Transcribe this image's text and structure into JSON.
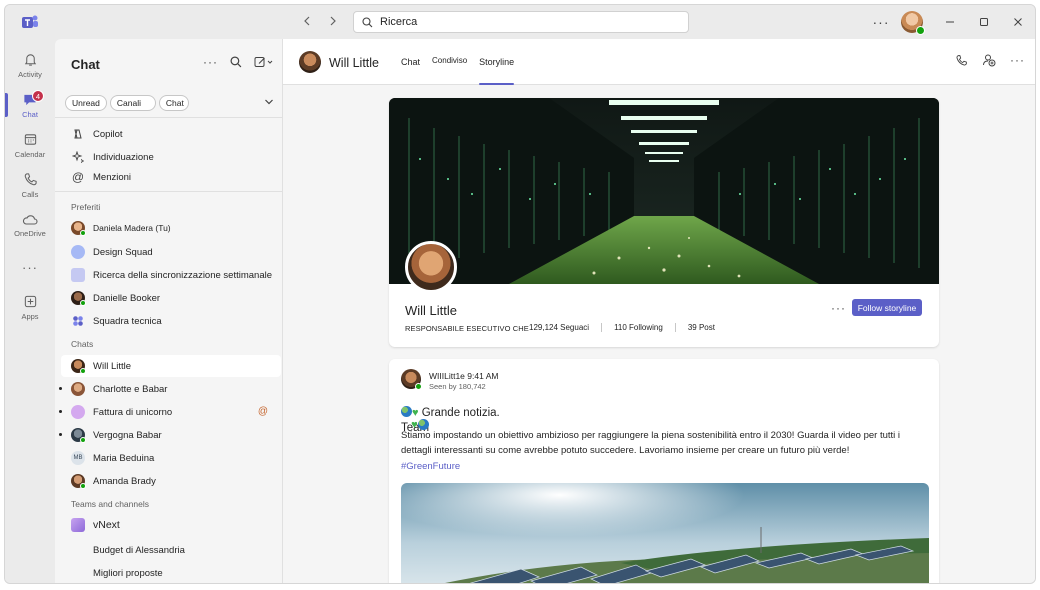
{
  "titlebar": {
    "search_placeholder": "Ricerca",
    "more": "···"
  },
  "rail": [
    {
      "label": "Activity",
      "icon": "bell-icon"
    },
    {
      "label": "Chat",
      "icon": "chat-icon",
      "badge": "4",
      "active": true
    },
    {
      "label": "Calendar",
      "icon": "calendar-icon"
    },
    {
      "label": "Calls",
      "icon": "phone-icon"
    },
    {
      "label": "OneDrive",
      "icon": "cloud-icon"
    },
    {
      "label": "···",
      "icon": "more-icon"
    },
    {
      "label": "Apps",
      "icon": "add-apps-icon"
    }
  ],
  "chatpanel": {
    "title": "Chat",
    "filters": [
      "Unread",
      "Canali",
      "Chat"
    ],
    "quick": [
      "Copilot",
      "Individuazione",
      "Menzioni"
    ],
    "favorites_label": "Preferiti",
    "favorites": [
      "Daniela Madera (Tu)",
      "Design Squad",
      "Ricerca della sincronizzazione settimanale",
      "Danielle Booker",
      "Squadra tecnica"
    ],
    "chats_label": "Chats",
    "chats": [
      "Will Little",
      "Charlotte e Babar",
      "Fattura di unicorno",
      "Vergogna Babar",
      "Maria Beduina",
      "Amanda Brady"
    ],
    "maria_initials": "MB",
    "teams_label": "Teams and channels",
    "teams": [
      "vNext",
      "Budget di Alessandria",
      "Migliori proposte"
    ],
    "mention_symbol": "@"
  },
  "header": {
    "name": "Will Little",
    "tabs": [
      "Chat",
      "Condiviso",
      "Storyline"
    ],
    "more": "···"
  },
  "profile": {
    "name": "Will Little",
    "role": "RESPONSABILE ESECUTIVO CHE",
    "followers": "129,124 Seguaci",
    "following": "110 Following",
    "posts": "39 Post",
    "more": "···",
    "follow_label": "Follow storyline"
  },
  "post": {
    "author": "WIIILitt1e 9:41 AM",
    "seen": "Seen by 180,742",
    "headline": "Grande notizia. Team",
    "body": "Stiamo impostando un obiettivo ambizioso per raggiungere la piena sostenibilità entro il 2030! Guarda il video per tutti i dettagli interessanti su come avrebbe potuto succedere. Lavoriamo insieme per creare un futuro più verde!",
    "tag": "#GreenFuture"
  },
  "colors": {
    "accent": "#5b5fc7",
    "badge": "#c4314b",
    "presence": "#13a10e",
    "mention": "#c5652d"
  }
}
